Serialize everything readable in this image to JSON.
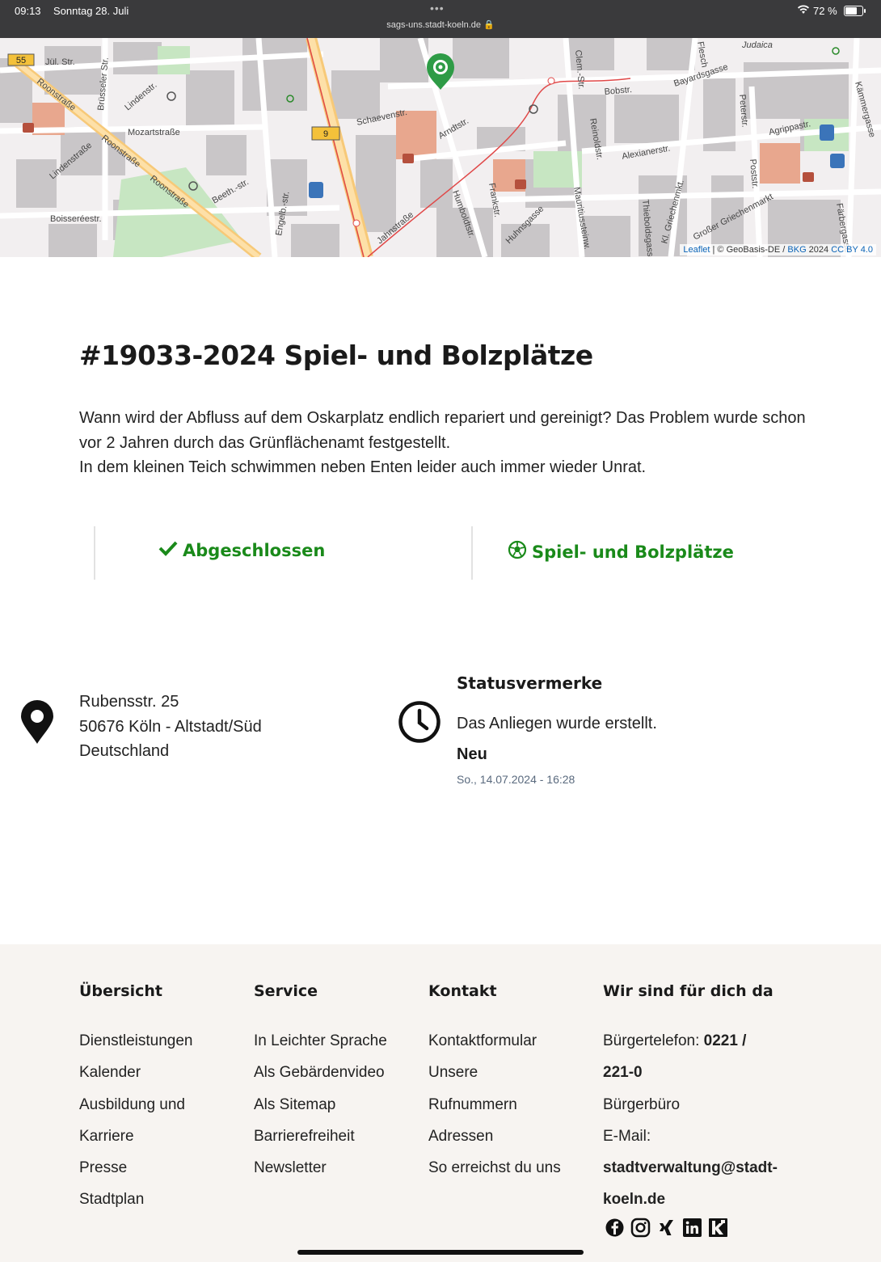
{
  "statusbar": {
    "time": "09:13",
    "date": "Sonntag 28. Juli",
    "url": "sags-uns.stadt-koeln.de 🔒",
    "battery_text": "72 %",
    "battery_level": 0.72
  },
  "map": {
    "streets": [
      "Jül. Str.",
      "Brüsseler Str.",
      "Lindenstr.",
      "Mozartstraße",
      "Roonstraße",
      "Roonstraße",
      "Roonstraße",
      "Lindenstraße",
      "Boisseréestr.",
      "Beeth.-str.",
      "Engelb.-str.",
      "Schaevenstr.",
      "Arndtstr.",
      "Humboldtstr.",
      "Frankstr.",
      "Jahnstraße",
      "Huhnsgasse",
      "Mauritiussteinw.",
      "Thieboldsgasse",
      "Kl. Griechenmkt.",
      "Großer Griechenmarkt",
      "Poststr.",
      "Peterstr.",
      "Agrippastr.",
      "Alexianerstr.",
      "Reinoldstr.",
      "Bobstr.",
      "Bayardsgasse",
      "Clem.-Str.",
      "Kämmergasse",
      "Färbergasse",
      "Judaica",
      "Flesch"
    ],
    "route_labels": [
      "55",
      "9"
    ],
    "attribution": {
      "leaflet": "Leaflet",
      "sep1": " | © GeoBasis-DE / ",
      "bkg": "BKG",
      "year": " 2024 ",
      "license": "CC BY 4.0"
    }
  },
  "issue": {
    "title": "#19033-2024 Spiel- und Bolzplätze",
    "description": [
      "Wann wird der Abfluss auf dem Oskarplatz endlich repariert und gereinigt? Das Problem wurde schon vor 2 Jahren durch das Grünflächenamt festgestellt.",
      "In dem kleinen Teich schwimmen neben Enten leider auch immer wieder Unrat."
    ],
    "status": "Abgeschlossen",
    "category": "Spiel- und Bolzplätze"
  },
  "address": {
    "line1": "Rubensstr. 25",
    "line2": "50676 Köln - Altstadt/Süd",
    "line3": "Deutschland"
  },
  "status_notes": {
    "heading": "Statusvermerke",
    "text": "Das Anliegen wurde erstellt.",
    "state": "Neu",
    "date": "So., 14.07.2024 - 16:28"
  },
  "footer": {
    "columns": [
      {
        "heading": "Übersicht",
        "links": [
          "Dienstleistungen",
          "Kalender",
          "Ausbildung und",
          "Karriere",
          "Presse",
          "Stadtplan"
        ]
      },
      {
        "heading": "Service",
        "links": [
          "In Leichter Sprache",
          "Als Gebärdenvideo",
          "Als Sitemap",
          "Barrierefreiheit",
          "Newsletter"
        ]
      },
      {
        "heading": "Kontakt",
        "links": [
          "Kontaktformular",
          "Unsere",
          "Rufnummern",
          "Adressen",
          "So erreichst du uns"
        ]
      },
      {
        "heading": "Wir sind für dich da"
      }
    ],
    "contact": {
      "phone_label": "Bürgertelefon: ",
      "phone_a": "0221 /",
      "phone_b": "221-0",
      "office": "Bürgerbüro",
      "email_label": "E-Mail:",
      "email_a": "stadtverwaltung@stadt-",
      "email_b": "koeln.de"
    },
    "social": [
      "facebook-icon",
      "instagram-icon",
      "xing-icon",
      "linkedin-icon",
      "kununu-icon"
    ]
  },
  "colors": {
    "accent_green": "#1a8a1a",
    "footer_bg": "#f7f4f1",
    "marker_green": "#2e9b46"
  }
}
